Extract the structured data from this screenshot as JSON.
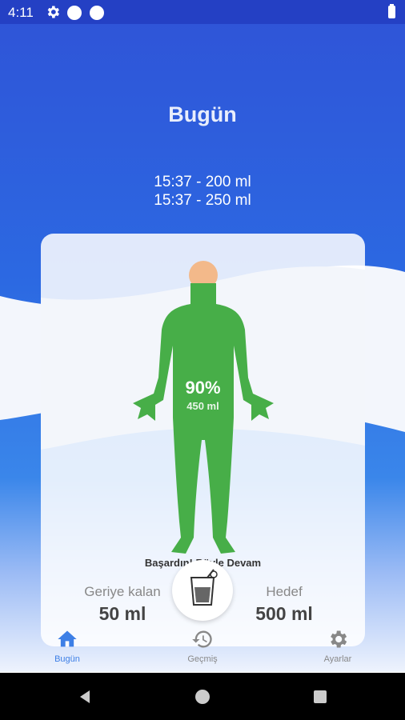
{
  "status_bar": {
    "time": "4:11"
  },
  "header": {
    "title": "Bugün"
  },
  "log": {
    "entries": [
      "15:37 - 200 ml",
      "15:37 - 250 ml"
    ]
  },
  "progress": {
    "percent_label": "90%",
    "amount_label": "450 ml",
    "fraction": 0.9
  },
  "message": "Başardın! Böyle Devam",
  "stats": {
    "remaining_label": "Geriye kalan",
    "remaining_value": "50 ml",
    "goal_label": "Hedef",
    "goal_value": "500 ml"
  },
  "nav": {
    "home": "Bugün",
    "history": "Geçmiş",
    "settings": "Ayarlar"
  },
  "colors": {
    "accent": "#3d7fe6",
    "body_fill": "#47ae48",
    "head": "#f3b98a"
  }
}
